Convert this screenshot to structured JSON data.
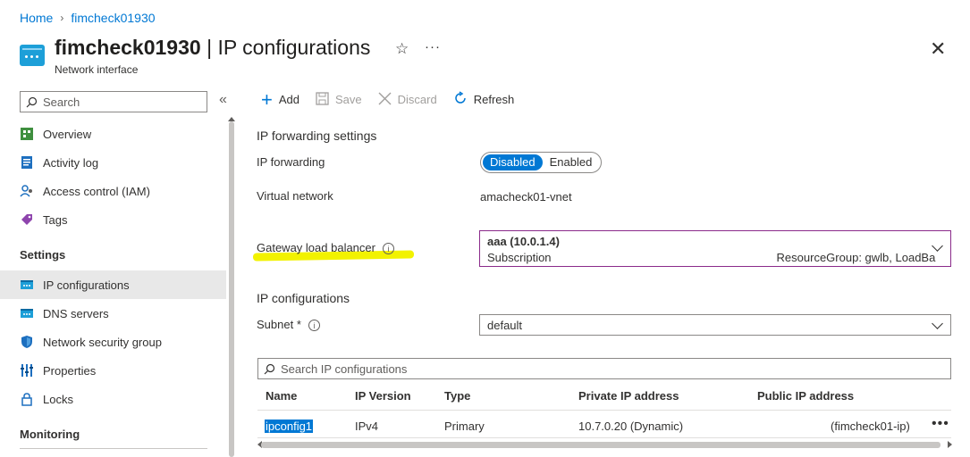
{
  "breadcrumb": {
    "home": "Home",
    "current": "fimcheck01930"
  },
  "header": {
    "resource_name": "fimcheck01930",
    "separator": " | ",
    "page_name": "IP configurations",
    "subtitle": "Network interface",
    "star": "☆",
    "more": "···",
    "close": "✕"
  },
  "sidebar": {
    "search_placeholder": "Search",
    "collapse": "«",
    "items": [
      {
        "label": "Overview",
        "icon": "overview-icon"
      },
      {
        "label": "Activity log",
        "icon": "activity-log-icon"
      },
      {
        "label": "Access control (IAM)",
        "icon": "iam-icon"
      },
      {
        "label": "Tags",
        "icon": "tag-icon"
      }
    ],
    "settings_heading": "Settings",
    "settings_items": [
      {
        "label": "IP configurations",
        "icon": "ip-config-icon",
        "active": true
      },
      {
        "label": "DNS servers",
        "icon": "dns-icon"
      },
      {
        "label": "Network security group",
        "icon": "shield-icon"
      },
      {
        "label": "Properties",
        "icon": "properties-icon"
      },
      {
        "label": "Locks",
        "icon": "lock-icon"
      }
    ],
    "monitoring_heading": "Monitoring"
  },
  "toolbar": {
    "add": "Add",
    "save": "Save",
    "discard": "Discard",
    "refresh": "Refresh"
  },
  "main": {
    "forwarding_title": "IP forwarding settings",
    "ip_forwarding_label": "IP forwarding",
    "toggle": {
      "disabled": "Disabled",
      "enabled": "Enabled",
      "selected": "Disabled"
    },
    "vnet_label": "Virtual network",
    "vnet_value": "amacheck01-vnet",
    "gateway_label": "Gateway load balancer",
    "gateway_value": "aaa (10.0.1.4)",
    "gateway_sub_prefix": "Subscription",
    "gateway_sub_suffix": "ResourceGroup: gwlb, LoadBa",
    "ipconfig_title": "IP configurations",
    "subnet_label": "Subnet",
    "subnet_required": "*",
    "subnet_value": "default",
    "ip_search_placeholder": "Search IP configurations"
  },
  "table": {
    "columns": [
      "Name",
      "IP Version",
      "Type",
      "Private IP address",
      "Public IP address"
    ],
    "rows": [
      {
        "name": "ipconfig1",
        "version": "IPv4",
        "type": "Primary",
        "private_ip": "10.7.0.20 (Dynamic)",
        "public_ip": "(fimcheck01-ip)"
      }
    ]
  },
  "colors": {
    "accent": "#0078d4",
    "highlight": "#f2f200",
    "gateway_border": "#8a2a8a"
  }
}
